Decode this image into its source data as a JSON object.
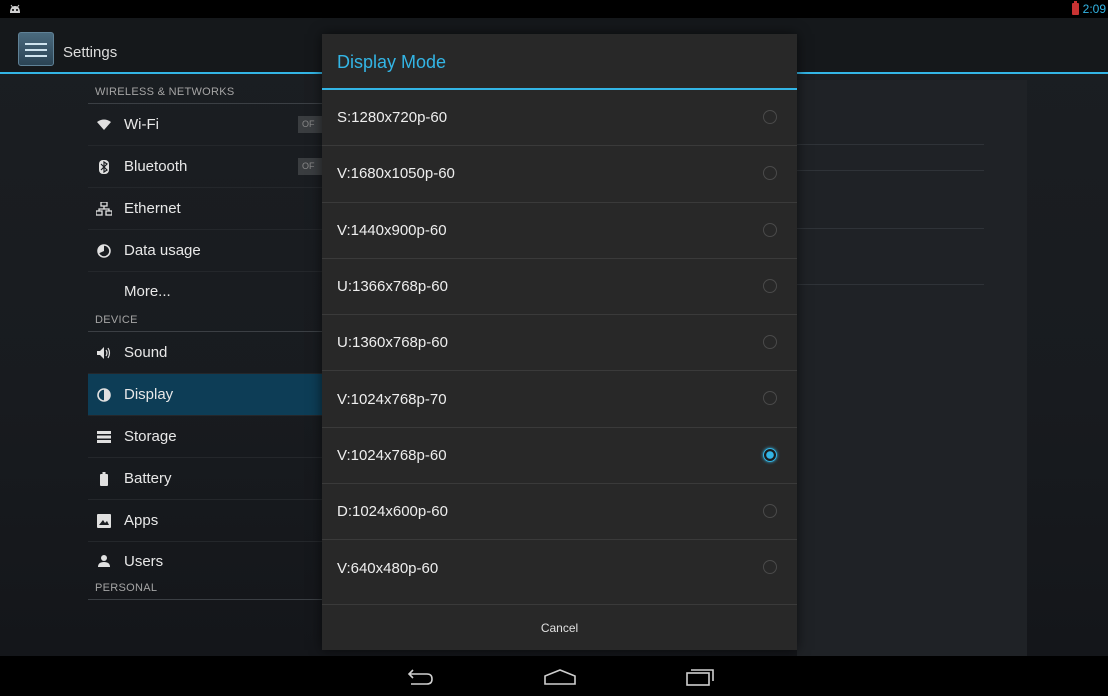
{
  "status_bar": {
    "time": "2:09",
    "accent_color": "#33b5e5",
    "battery_color": "#c93333"
  },
  "action_bar": {
    "title": "Settings",
    "icon": "settings-icon"
  },
  "left_list": {
    "sections": [
      {
        "header": "WIRELESS & NETWORKS",
        "items": [
          {
            "label": "Wi-Fi",
            "icon": "wifi-icon",
            "toggle": "OF"
          },
          {
            "label": "Bluetooth",
            "icon": "bluetooth-icon",
            "toggle": "OF"
          },
          {
            "label": "Ethernet",
            "icon": "ethernet-icon"
          },
          {
            "label": "Data usage",
            "icon": "data-usage-icon"
          },
          {
            "label": "More...",
            "icon": ""
          }
        ]
      },
      {
        "header": "DEVICE",
        "items": [
          {
            "label": "Sound",
            "icon": "sound-icon"
          },
          {
            "label": "Display",
            "icon": "display-icon",
            "selected": true
          },
          {
            "label": "Storage",
            "icon": "storage-icon"
          },
          {
            "label": "Battery",
            "icon": "battery-icon"
          },
          {
            "label": "Apps",
            "icon": "apps-icon"
          },
          {
            "label": "Users",
            "icon": "users-icon"
          }
        ]
      },
      {
        "header": "PERSONAL",
        "items": []
      }
    ]
  },
  "dialog": {
    "title": "Display Mode",
    "selected_index": 6,
    "options": [
      "S:1280x720p-60",
      "V:1680x1050p-60",
      "V:1440x900p-60",
      "U:1366x768p-60",
      "U:1360x768p-60",
      "V:1024x768p-70",
      "V:1024x768p-60",
      "D:1024x600p-60",
      "V:640x480p-60"
    ],
    "cancel_label": "Cancel"
  },
  "nav_bar": {
    "buttons": [
      "back-icon",
      "home-icon",
      "recents-icon"
    ]
  }
}
